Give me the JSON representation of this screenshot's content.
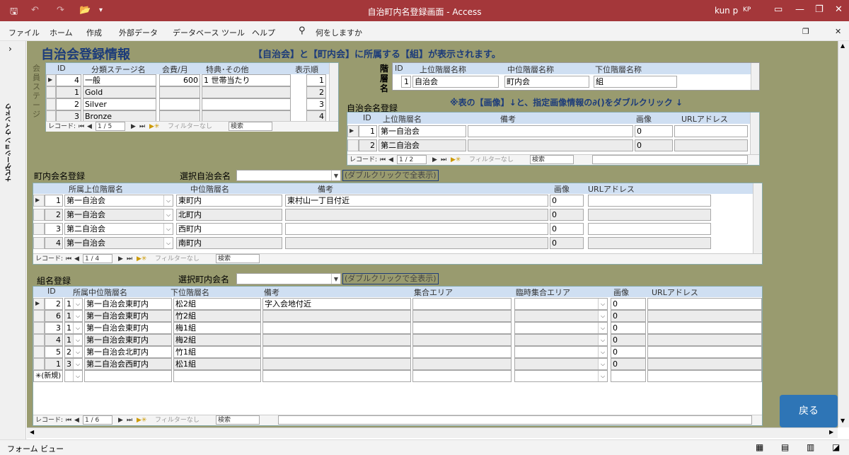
{
  "window": {
    "title": "自治町内名登録画面 - Access",
    "user": "kun p",
    "initials": "KP"
  },
  "ribbon": {
    "menus": [
      "ファイル",
      "ホーム",
      "作成",
      "外部データ",
      "データベース ツール",
      "ヘルプ"
    ],
    "tell_me": "何をしますか"
  },
  "nav_pane": {
    "label": "ナビゲーション ウィンドウ"
  },
  "form": {
    "title": "自治会登録情報",
    "info": "【自治会】と【町内会】に所属する【組】が表示されます。",
    "hint": "※表の【画像】↓と、指定画像情報の∂()をダブルクリック ↓",
    "back_button": "戻る"
  },
  "membership": {
    "side_label": "会員ステージ",
    "headers": [
      "ID",
      "分類ステージ名",
      "会費/月",
      "特典･その他",
      "表示順"
    ],
    "rows": [
      {
        "id": "4",
        "name": "一般",
        "fee": "600",
        "benefit": "1 世帯当たり",
        "order": "1"
      },
      {
        "id": "1",
        "name": "Gold",
        "fee": "",
        "benefit": "",
        "order": "2"
      },
      {
        "id": "2",
        "name": "Silver",
        "fee": "",
        "benefit": "",
        "order": "3"
      },
      {
        "id": "3",
        "name": "Bronze",
        "fee": "",
        "benefit": "",
        "order": "4"
      }
    ],
    "nav": {
      "label": "レコード:",
      "position": "1 / 5",
      "filter": "フィルターなし",
      "search": "検索"
    }
  },
  "hierarchy": {
    "side_label": "階層名",
    "headers": [
      "ID",
      "上位階層名称",
      "中位階層名称",
      "下位階層名称"
    ],
    "row": {
      "id": "1",
      "upper": "自治会",
      "middle": "町内会",
      "lower": "組"
    }
  },
  "jichikai": {
    "title": "自治会名登録",
    "headers": [
      "ID",
      "上位階層名",
      "備考",
      "画像",
      "URLアドレス"
    ],
    "rows": [
      {
        "id": "1",
        "name": "第一自治会",
        "note": "",
        "image": "0",
        "url": ""
      },
      {
        "id": "2",
        "name": "第二自治会",
        "note": "",
        "image": "0",
        "url": ""
      }
    ],
    "nav": {
      "label": "レコード:",
      "position": "1 / 2",
      "filter": "フィルターなし",
      "search": "検索"
    }
  },
  "chounai": {
    "title": "町内会名登録",
    "select_label": "選択自治会名",
    "select_value": "",
    "double_click_btn": "(ダブルクリックで全表示)",
    "headers": [
      "所属上位階層名",
      "中位階層名",
      "備考",
      "画像",
      "URLアドレス"
    ],
    "rows": [
      {
        "id": "1",
        "upper": "第一自治会",
        "middle": "東町内",
        "note": "東村山一丁目付近",
        "image": "0",
        "url": ""
      },
      {
        "id": "2",
        "upper": "第一自治会",
        "middle": "北町内",
        "note": "",
        "image": "0",
        "url": ""
      },
      {
        "id": "3",
        "upper": "第二自治会",
        "middle": "西町内",
        "note": "",
        "image": "0",
        "url": ""
      },
      {
        "id": "4",
        "upper": "第一自治会",
        "middle": "南町内",
        "note": "",
        "image": "0",
        "url": ""
      }
    ],
    "nav": {
      "label": "レコード:",
      "position": "1 / 4",
      "filter": "フィルターなし",
      "search": "検索"
    }
  },
  "kumi": {
    "title": "組名登録",
    "select_label": "選択町内会名",
    "select_value": "",
    "double_click_btn": "(ダブルクリックで全表示)",
    "headers": [
      "ID",
      "所属中位階層名",
      "下位階層名",
      "備考",
      "集合エリア",
      "臨時集合エリア",
      "画像",
      "URLアドレス"
    ],
    "rows": [
      {
        "id": "2",
        "sel": "1",
        "middle": "第一自治会東町内",
        "lower": "松2組",
        "note": "字入会地付近",
        "image": "0"
      },
      {
        "id": "6",
        "sel": "1",
        "middle": "第一自治会東町内",
        "lower": "竹2組",
        "note": "",
        "image": "0"
      },
      {
        "id": "3",
        "sel": "1",
        "middle": "第一自治会東町内",
        "lower": "梅1組",
        "note": "",
        "image": "0"
      },
      {
        "id": "4",
        "sel": "1",
        "middle": "第一自治会東町内",
        "lower": "梅2組",
        "note": "",
        "image": "0"
      },
      {
        "id": "5",
        "sel": "2",
        "middle": "第一自治会北町内",
        "lower": "竹1組",
        "note": "",
        "image": "0"
      },
      {
        "id": "1",
        "sel": "3",
        "middle": "第二自治会西町内",
        "lower": "松1組",
        "note": "",
        "image": "0"
      }
    ],
    "new_row": "✳(新規)",
    "nav": {
      "label": "レコード:",
      "position": "1 / 6",
      "filter": "フィルターなし",
      "search": "検索"
    }
  },
  "status": {
    "view": "フォーム ビュー"
  }
}
